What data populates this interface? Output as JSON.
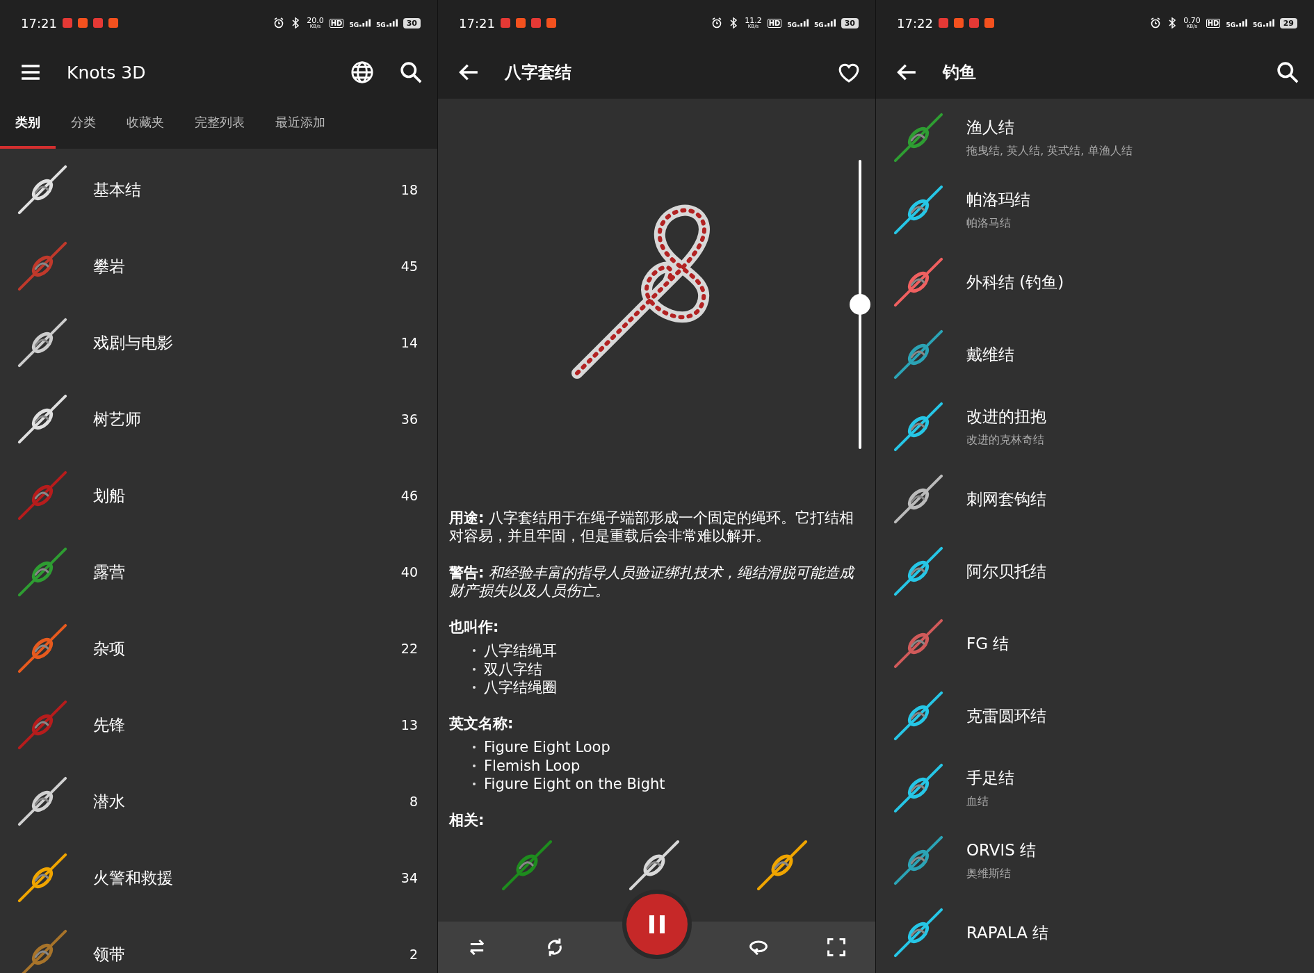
{
  "categories_screen": {
    "status_bar": {
      "time": "17:21",
      "net_speed": "20.0",
      "net_unit": "KB/s",
      "hd": "HD",
      "signals": [
        "5G",
        "5G"
      ],
      "battery": "30"
    },
    "app_bar": {
      "title": "Knots 3D"
    },
    "tabs": [
      {
        "label": "类别",
        "selected": true
      },
      {
        "label": "分类",
        "selected": false
      },
      {
        "label": "收藏夹",
        "selected": false
      },
      {
        "label": "完整列表",
        "selected": false
      },
      {
        "label": "最近添加",
        "selected": false
      }
    ],
    "items": [
      {
        "name": "基本结",
        "count": "18"
      },
      {
        "name": "攀岩",
        "count": "45"
      },
      {
        "name": "戏剧与电影",
        "count": "14"
      },
      {
        "name": "树艺师",
        "count": "36"
      },
      {
        "name": "划船",
        "count": "46"
      },
      {
        "name": "露营",
        "count": "40"
      },
      {
        "name": "杂项",
        "count": "22"
      },
      {
        "name": "先锋",
        "count": "13"
      },
      {
        "name": "潜水",
        "count": "8"
      },
      {
        "name": "火警和救援",
        "count": "34"
      },
      {
        "name": "领带",
        "count": "2"
      }
    ]
  },
  "knot_screen": {
    "status_bar": {
      "time": "17:21",
      "net_speed": "11.2",
      "net_unit": "KB/s",
      "hd": "HD",
      "signals": [
        "5G",
        "5G"
      ],
      "battery": "30"
    },
    "app_bar": {
      "title": "八字套结",
      "favorite": false
    },
    "zoom_slider": {
      "level": 0.5
    },
    "usage": "**用途:** 八字套结用于在绳子端部形成一个固定的绳环。它打结相对容易，并且牢固，但是重载后会非常难以解开。",
    "warning": "**警告:** *和经验丰富的指导人员验证绑扎技术，绳结滑脱可能造成财产损失以及人员伤亡。*",
    "also_known_as": {
      "heading": "也叫作:",
      "items": [
        "八字结绳耳",
        "双八字结",
        "八字结绳圈"
      ]
    },
    "english_names": {
      "heading": "英文名称:",
      "items": [
        "Figure Eight Loop",
        "Flemish Loop",
        "Figure Eight on the Bight"
      ]
    },
    "related": {
      "heading": "相关:"
    },
    "playback": {
      "playing": true
    }
  },
  "fishing_screen": {
    "status_bar": {
      "time": "17:22",
      "net_speed": "0.70",
      "net_unit": "KB/s",
      "hd": "HD",
      "signals": [
        "5G",
        "5G"
      ],
      "battery": "29"
    },
    "app_bar": {
      "title": "钓鱼"
    },
    "items": [
      {
        "name": "渔人结",
        "subtitle": "拖曳结, 英人结, 英式结, 单渔人结"
      },
      {
        "name": "帕洛玛结",
        "subtitle": "帕洛马结"
      },
      {
        "name": "外科结 (钓鱼)"
      },
      {
        "name": "戴维结"
      },
      {
        "name": "改进的扭抱",
        "subtitle": "改进的克林奇结"
      },
      {
        "name": "刺网套钩结"
      },
      {
        "name": "阿尔贝托结"
      },
      {
        "name": "FG 结"
      },
      {
        "name": "克雷圆环结"
      },
      {
        "name": "手足结",
        "subtitle": "血结"
      },
      {
        "name": "ORVIS 结",
        "subtitle": "奥维斯结"
      },
      {
        "name": "RAPALA 结"
      }
    ]
  }
}
